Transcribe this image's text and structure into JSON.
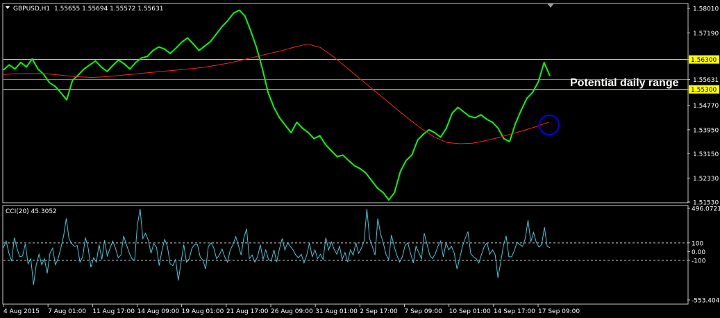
{
  "chart_data": [
    {
      "type": "line",
      "title": "GBPUSD,H1",
      "ohlc_header": "1.55655 1.55694 1.55572 1.55631",
      "ylim": [
        1.5153,
        1.5815
      ],
      "y_ticks": [
        "1.58010",
        "1.57190",
        "1.56300",
        "1.55631",
        "1.55300",
        "1.54770",
        "1.53950",
        "1.53150",
        "1.52330",
        "1.51530"
      ],
      "x_ticks": [
        "4 Aug 2015",
        "7 Aug 01:00",
        "11 Aug 17:00",
        "14 Aug 09:00",
        "19 Aug 01:00",
        "21 Aug 17:00",
        "26 Aug 09:00",
        "31 Aug 01:00",
        "2 Sep 17:00",
        "7 Sep 09:00",
        "10 Sep 01:00",
        "14 Sep 17:00",
        "17 Sep 09:00"
      ],
      "horizontal_levels": [
        {
          "value": 1.563,
          "label": "1.56300",
          "color": "#ffff00"
        },
        {
          "value": 1.553,
          "label": "1.55300",
          "color": "#ffff00"
        },
        {
          "value": 1.55631,
          "label": "1.55631",
          "color": "#7f7f7f"
        }
      ],
      "annotation": "Potential daily range",
      "series": [
        {
          "color": "#00ff00",
          "values": [
            1.5595,
            1.5612,
            1.5598,
            1.562,
            1.5605,
            1.5632,
            1.5598,
            1.558,
            1.5552,
            1.554,
            1.5518,
            1.5495,
            1.556,
            1.5578,
            1.5598,
            1.5612,
            1.5625,
            1.5605,
            1.559,
            1.561,
            1.5628,
            1.5615,
            1.5598,
            1.562,
            1.5635,
            1.564,
            1.566,
            1.5672,
            1.5665,
            1.565,
            1.5668,
            1.5688,
            1.5702,
            1.5682,
            1.566,
            1.5675,
            1.569,
            1.5715,
            1.574,
            1.576,
            1.5785,
            1.5795,
            1.5775,
            1.5725,
            1.567,
            1.56,
            1.552,
            1.547,
            1.5435,
            1.541,
            1.5385,
            1.542,
            1.54,
            1.5385,
            1.5365,
            1.5375,
            1.5345,
            1.5325,
            1.5305,
            1.531,
            1.5292,
            1.5275,
            1.5265,
            1.525,
            1.5225,
            1.52,
            1.5185,
            1.516,
            1.5185,
            1.5255,
            1.5292,
            1.531,
            1.536,
            1.538,
            1.5395,
            1.5385,
            1.537,
            1.54,
            1.545,
            1.547,
            1.5455,
            1.544,
            1.5435,
            1.5445,
            1.543,
            1.542,
            1.54,
            1.5365,
            1.5355,
            1.5415,
            1.546,
            1.55,
            1.552,
            1.5555,
            1.562,
            1.5575
          ]
        },
        {
          "color": "#ff2020",
          "values": [
            1.558,
            1.5582,
            1.5583,
            1.5583,
            1.558,
            1.5575,
            1.5572,
            1.557,
            1.5572,
            1.5576,
            1.558,
            1.5584,
            1.5588,
            1.5592,
            1.5596,
            1.56,
            1.5605,
            1.5612,
            1.562,
            1.563,
            1.564,
            1.565,
            1.566,
            1.5672,
            1.5682,
            1.567,
            1.564,
            1.5605,
            1.557,
            1.5535,
            1.55,
            1.5465,
            1.543,
            1.5398,
            1.537,
            1.5352,
            1.5348,
            1.535,
            1.5358,
            1.5368,
            1.538,
            1.5392,
            1.5405,
            1.542
          ]
        }
      ],
      "marker": {
        "shape": "circle",
        "color": "#0000ff"
      }
    },
    {
      "type": "line",
      "title": "CCI(20) 45.3052",
      "ylim": [
        -553.4042,
        496.0721
      ],
      "y_ticks": [
        "496.0721",
        "100",
        "0.00",
        "-100",
        "-553.4042"
      ],
      "levels": [
        100,
        -100
      ],
      "series": [
        {
          "color": "#40c8d8",
          "values": [
            45,
            120,
            -20,
            -110,
            160,
            30,
            -60,
            -50,
            90,
            -140,
            -80,
            -380,
            -150,
            -30,
            -150,
            -80,
            -250,
            -20,
            40,
            -150,
            -80,
            40,
            180,
            380,
            150,
            90,
            60,
            70,
            -120,
            -60,
            160,
            40,
            -180,
            -70,
            -120,
            80,
            -90,
            130,
            -50,
            40,
            120,
            40,
            -70,
            -40,
            180,
            80,
            -10,
            -80,
            -100,
            300,
            490,
            150,
            210,
            130,
            -20,
            90,
            50,
            -160,
            10,
            140,
            60,
            -140,
            -160,
            -90,
            -330,
            -120,
            80,
            -120,
            -80,
            40,
            80,
            80,
            -60,
            -100,
            -200,
            60,
            100,
            40,
            -80,
            -40,
            30,
            -60,
            -120,
            20,
            80,
            170,
            70,
            -40,
            160,
            260,
            -80,
            -40,
            -120,
            -60,
            80,
            -90,
            20,
            -90,
            -110,
            20,
            -120,
            30,
            150,
            20,
            100,
            60,
            20,
            -40,
            -70,
            -30,
            -130,
            -40,
            100,
            -60,
            20,
            -80,
            -30,
            -90,
            160,
            20,
            110,
            30,
            -30,
            60,
            -90,
            -10,
            -120,
            20,
            -40,
            100,
            -20,
            40,
            120,
            490,
            150,
            60,
            -40,
            380,
            210,
            100,
            -30,
            -90,
            190,
            60,
            -40,
            -120,
            -60,
            70,
            100,
            -20,
            -130,
            60,
            -10,
            -80,
            210,
            90,
            -40,
            -80,
            -30,
            60,
            120,
            -60,
            100,
            20,
            60,
            -20,
            -200,
            -80,
            60,
            150,
            230,
            -20,
            -60,
            -80,
            -130,
            -30,
            60,
            100,
            -30,
            20,
            -40,
            -300,
            -120,
            70,
            180,
            -60,
            -60,
            10,
            110,
            80,
            60,
            150,
            360,
            110,
            220,
            110,
            50,
            80,
            280,
            60,
            45
          ]
        }
      ]
    }
  ]
}
